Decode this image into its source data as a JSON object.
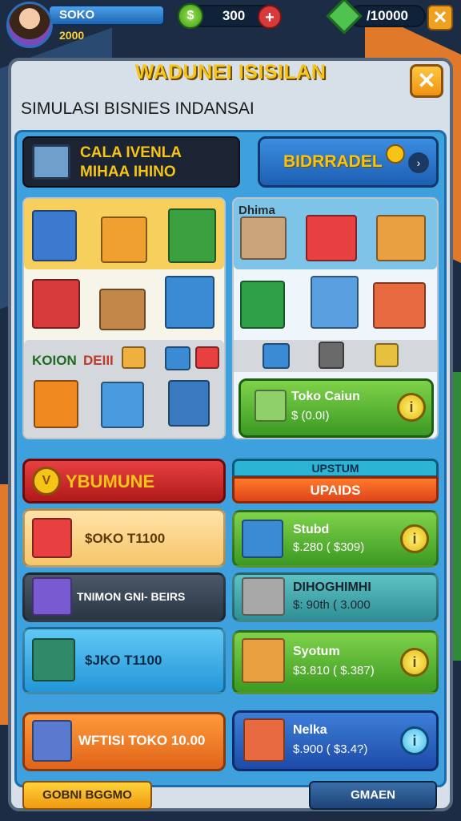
{
  "player": {
    "name": "SOKO",
    "level": "2000"
  },
  "resources": {
    "coins": "300",
    "gems": "/10000",
    "plus": "+",
    "coin_symbol": "$"
  },
  "close_top_label": "✕",
  "panel": {
    "title": "WADUNEI ISISILAN",
    "subtitle": "SIMULASI BISNIES INDANSAI",
    "close_label": "✕"
  },
  "tabs": {
    "dark_line1": "CALA IVENLA",
    "dark_line2": "MIHAA IHINO",
    "blue_label": "BIDRRADEL",
    "blue_arrow": "›"
  },
  "grid": {
    "top_right_label": "Dhima",
    "row3_left_a": "KOION",
    "row3_left_b": "DEIII"
  },
  "shop_card": {
    "title": "Toko Caiun",
    "price": "$ (0.0I)",
    "button": "i"
  },
  "left_column": {
    "banner": "YBUMUNE",
    "banner_icon": "V",
    "item1": "$OKO T1100",
    "item2": "TNIMON GNI- BEIRS",
    "item3": "$JKO T1100",
    "item4": "WFTISI TOKO 10.00"
  },
  "right_column": {
    "banner_top": "UPSTUM",
    "banner_bottom": "UPAIDS",
    "item1_title": "Stubd",
    "item1_price": "$.280 ( $309)",
    "item2_title": "DIHOGHIMHI",
    "item2_price": "$: 90th ( 3.000",
    "item3_title": "Syotum",
    "item3_price": "$3.810 ( $.387)",
    "item4_title": "Nelka",
    "item4_price": "$.900 ( $3.4?)",
    "button": "i"
  },
  "bottom": {
    "left_button": "GOBNI BGGMO",
    "right_button": "GMAEN"
  },
  "colors": {
    "accent_gold": "#f5c417",
    "panel_blue": "#3ea0dc",
    "card_green": "#3b9a22",
    "card_red": "#b01a1a"
  }
}
